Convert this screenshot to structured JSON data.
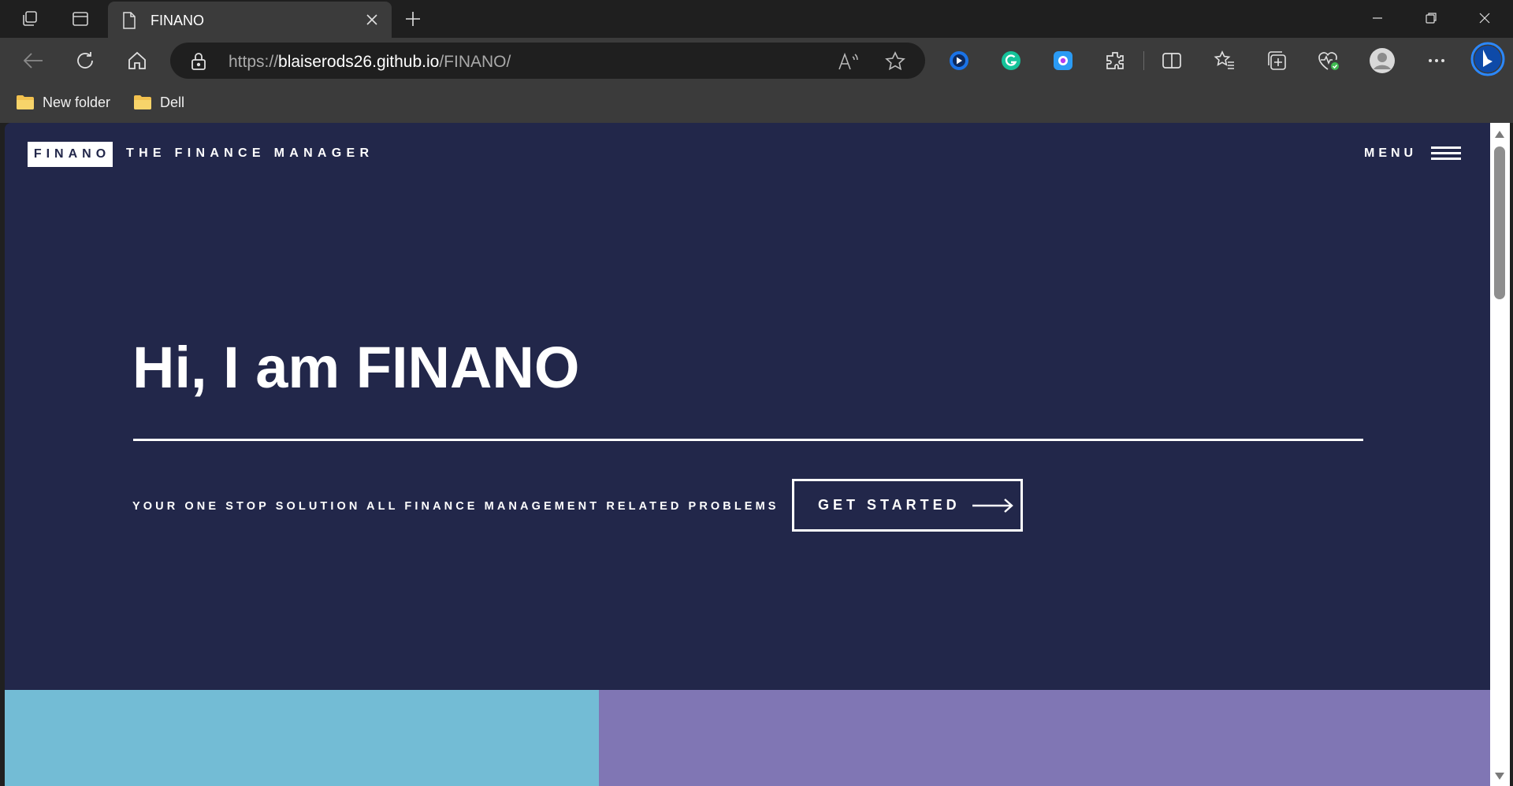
{
  "browser": {
    "tab": {
      "title": "FINANO",
      "icon": "document-icon"
    },
    "address_bar": {
      "url_scheme": "https://",
      "url_host": "blaiserods26.github.io",
      "url_path": "/FINANO/"
    },
    "bookmarks": [
      {
        "label": "New folder",
        "icon": "folder-icon"
      },
      {
        "label": "Dell",
        "icon": "folder-icon"
      }
    ],
    "extensions": [
      "video-extension-icon",
      "grammarly-icon",
      "screen-capture-extension-icon",
      "extensions-icon"
    ],
    "colors": {
      "frame": "#1f1f1f",
      "toolbar": "#3b3b3b",
      "address": "#1f1f1f"
    }
  },
  "page": {
    "logo": "FINANO",
    "tagline": "THE FINANCE MANAGER",
    "menu_label": "MENU",
    "hero": {
      "title": "Hi, I am FINANO",
      "subtitle": "YOUR ONE STOP SOLUTION ALL FINANCE MANAGEMENT RELATED PROBLEMS",
      "cta_label": "GET STARTED"
    },
    "colors": {
      "background": "#22274a",
      "accent_teal": "#73bcd5",
      "accent_purple": "#8076b4"
    }
  }
}
